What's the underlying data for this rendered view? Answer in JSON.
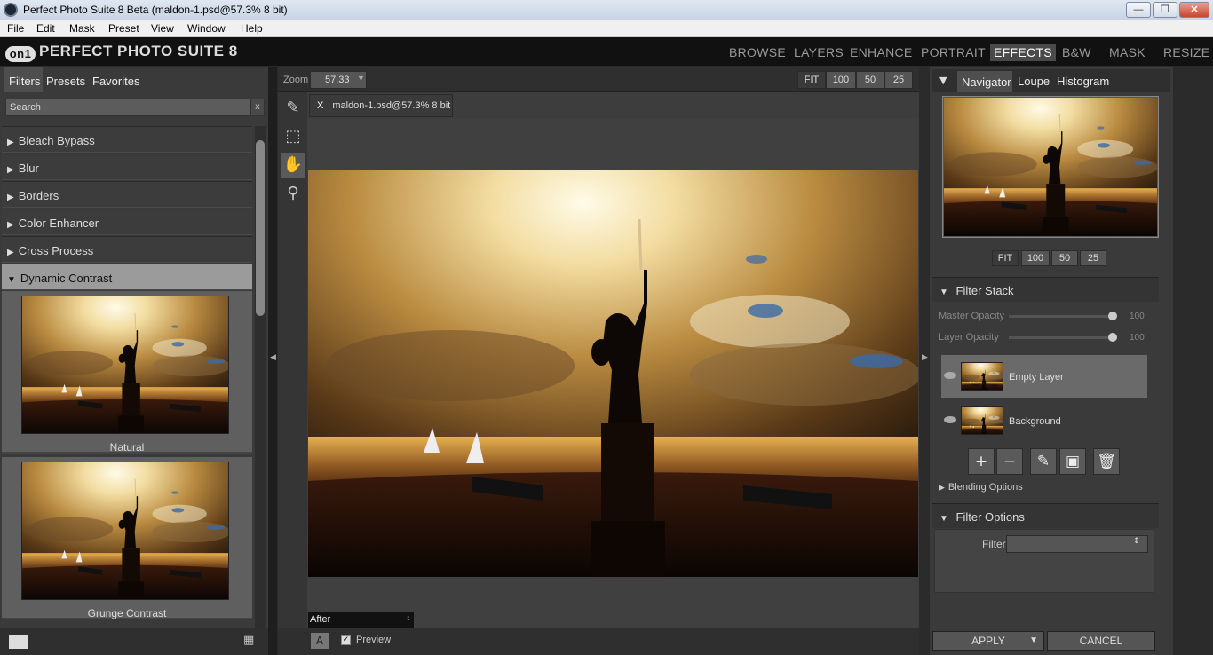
{
  "window": {
    "title": "Perfect Photo Suite 8 Beta (maldon-1.psd@57.3% 8 bit)"
  },
  "menu": [
    "File",
    "Edit",
    "Mask",
    "Preset",
    "View",
    "Window",
    "Help"
  ],
  "app": {
    "logo_mark": "on1",
    "logo_text": "PERFECT PHOTO SUITE 8",
    "modules": [
      "BROWSE",
      "LAYERS",
      "ENHANCE",
      "PORTRAIT",
      "EFFECTS",
      "B&W",
      "MASK",
      "RESIZE"
    ],
    "active_module": "EFFECTS"
  },
  "left_panel": {
    "tabs": [
      "Filters",
      "Presets",
      "Favorites"
    ],
    "active_tab": "Filters",
    "search_placeholder": "Search",
    "search_clear": "x",
    "filters": [
      "Bleach Bypass",
      "Blur",
      "Borders",
      "Color Enhancer",
      "Cross Process",
      "Dynamic Contrast"
    ],
    "open_filter": "Dynamic Contrast",
    "presets": [
      "Natural",
      "Grunge Contrast"
    ]
  },
  "center": {
    "zoom_label": "Zoom",
    "zoom_value": "57.33",
    "zoom_buttons": [
      "FIT",
      "100",
      "50",
      "25"
    ],
    "doc_close": "X",
    "doc_tab": "maldon-1.psd@57.3% 8 bit",
    "view_mode": "After",
    "a_button": "A",
    "preview_label": "Preview",
    "preview_checked": true
  },
  "right_panel": {
    "tabs": [
      "Navigator",
      "Loupe",
      "Histogram"
    ],
    "active_tab": "Navigator",
    "zoom_buttons": [
      "FIT",
      "100",
      "50",
      "25"
    ],
    "filter_stack": {
      "title": "Filter Stack",
      "master_opacity_label": "Master Opacity",
      "master_opacity": "100",
      "layer_opacity_label": "Layer Opacity",
      "layer_opacity": "100",
      "layers": [
        "Empty Layer",
        "Background"
      ],
      "selected_layer": "Empty Layer",
      "blending_options": "Blending Options"
    },
    "filter_options": {
      "title": "Filter Options",
      "filter_label": "Filter"
    },
    "apply_label": "APPLY",
    "cancel_label": "CANCEL"
  },
  "colors": {
    "accent_active_tab": "#4a4a4a",
    "panel_bg": "#3a3a3a",
    "header_bg": "#111111"
  }
}
